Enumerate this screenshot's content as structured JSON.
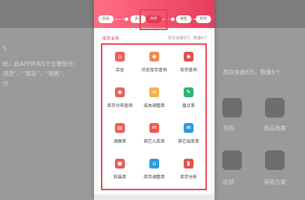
{
  "stepper": {
    "steps": [
      "商品",
      "进货",
      "库存",
      "销售",
      "财务"
    ],
    "active_index": 2
  },
  "panel": {
    "title": "库存业务",
    "info": "库存金额8万，数量8个"
  },
  "grid": [
    {
      "label": "店仓",
      "icon": "store-icon",
      "color": "#f0605f",
      "glyph": "⌂"
    },
    {
      "label": "历史库存查询",
      "icon": "history-inventory-icon",
      "color": "#f28a4d",
      "glyph": "◆"
    },
    {
      "label": "库存查询",
      "icon": "inventory-query-icon",
      "color": "#e8504d",
      "glyph": "◆"
    },
    {
      "label": "库存分布查询",
      "icon": "distribution-icon",
      "color": "#f0605f",
      "glyph": "◆"
    },
    {
      "label": "成本调整单",
      "icon": "cost-adjust-icon",
      "color": "#f2b14a",
      "glyph": "≡"
    },
    {
      "label": "盘点单",
      "icon": "stocktake-icon",
      "color": "#2fb277",
      "glyph": "✎"
    },
    {
      "label": "调拨单",
      "icon": "transfer-icon",
      "color": "#ef5a4f",
      "glyph": "▤"
    },
    {
      "label": "其它入库单",
      "icon": "other-inbound-icon",
      "color": "#ef5a4f",
      "glyph": "✉"
    },
    {
      "label": "其它出库单",
      "icon": "other-outbound-icon",
      "color": "#2d9be0",
      "glyph": "✉"
    },
    {
      "label": "拆装单",
      "icon": "assembly-icon",
      "color": "#ef5a4f",
      "glyph": "▣"
    },
    {
      "label": "库存调整单",
      "icon": "inventory-adjust-icon",
      "color": "#2d9be0",
      "glyph": "⌂"
    },
    {
      "label": "库存分析",
      "icon": "inventory-analysis-icon",
      "color": "#e8504d",
      "glyph": "▮"
    }
  ],
  "background": {
    "fragment_left_1": "5",
    "fragment_left_2": "统，此APP共有5个主要部分：",
    "fragment_left_3": "进货”、“库存”、“销售”、",
    "fragment_left_4": "分",
    "fragment_right_info": "库存金额8万，数量8个",
    "right_tiles": [
      "商品档案",
      "导购",
      "采购方案",
      "促销"
    ]
  }
}
